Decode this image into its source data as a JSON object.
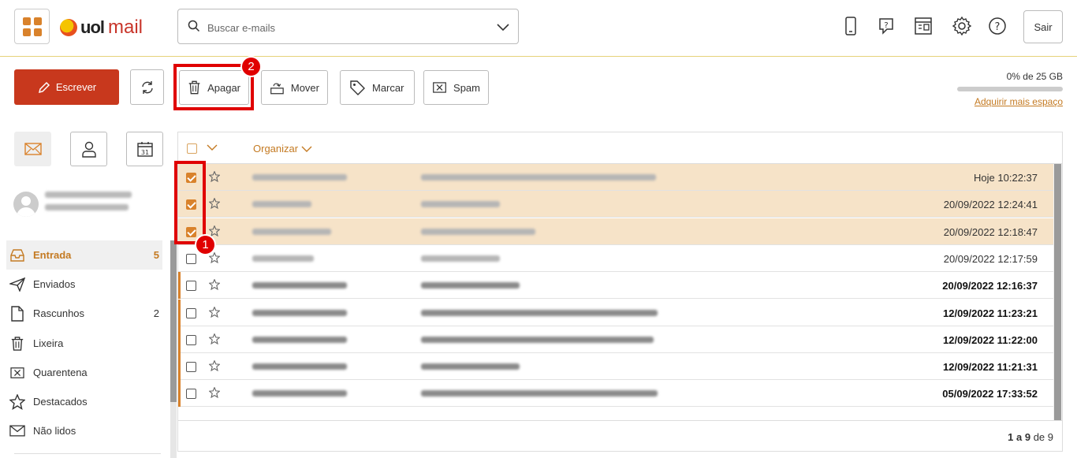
{
  "header": {
    "brand": "uol",
    "product": "mail",
    "search_placeholder": "Buscar e-mails",
    "logout_label": "Sair"
  },
  "toolbar": {
    "write_label": "Escrever",
    "delete_label": "Apagar",
    "move_label": "Mover",
    "mark_label": "Marcar",
    "spam_label": "Spam"
  },
  "annotations": {
    "step1": "1",
    "step2": "2"
  },
  "quota": {
    "usage": "0% de 25 GB",
    "used_fraction": 0.0,
    "link": "Adquirir mais espaço"
  },
  "sidebar": {
    "folders": [
      {
        "label": "Entrada",
        "count": "5",
        "icon": "inbox-icon"
      },
      {
        "label": "Enviados",
        "count": "",
        "icon": "send-icon"
      },
      {
        "label": "Rascunhos",
        "count": "2",
        "icon": "draft-icon"
      },
      {
        "label": "Lixeira",
        "count": "",
        "icon": "trash-icon"
      },
      {
        "label": "Quarentena",
        "count": "",
        "icon": "quarantine-icon"
      },
      {
        "label": "Destacados",
        "count": "",
        "icon": "star-icon"
      },
      {
        "label": "Não lidos",
        "count": "",
        "icon": "envelope-icon"
      }
    ]
  },
  "list": {
    "sort_label": "Organizar",
    "pager": {
      "range": "1 a 9",
      "of": "de 9"
    },
    "rows": [
      {
        "date": "Hoje 10:22:37",
        "checked": true,
        "unread": false
      },
      {
        "date": "20/09/2022 12:24:41",
        "checked": true,
        "unread": false
      },
      {
        "date": "20/09/2022 12:18:47",
        "checked": true,
        "unread": false
      },
      {
        "date": "20/09/2022 12:17:59",
        "checked": false,
        "unread": false
      },
      {
        "date": "20/09/2022 12:16:37",
        "checked": false,
        "unread": true
      },
      {
        "date": "12/09/2022 11:23:21",
        "checked": false,
        "unread": true
      },
      {
        "date": "12/09/2022 11:22:00",
        "checked": false,
        "unread": true
      },
      {
        "date": "12/09/2022 11:21:31",
        "checked": false,
        "unread": true
      },
      {
        "date": "05/09/2022 17:33:52",
        "checked": false,
        "unread": true
      }
    ]
  },
  "colors": {
    "accent": "#d9822b",
    "write_button": "#c8381d",
    "selected_row": "#f6e3c8",
    "annotation": "#e00000"
  }
}
